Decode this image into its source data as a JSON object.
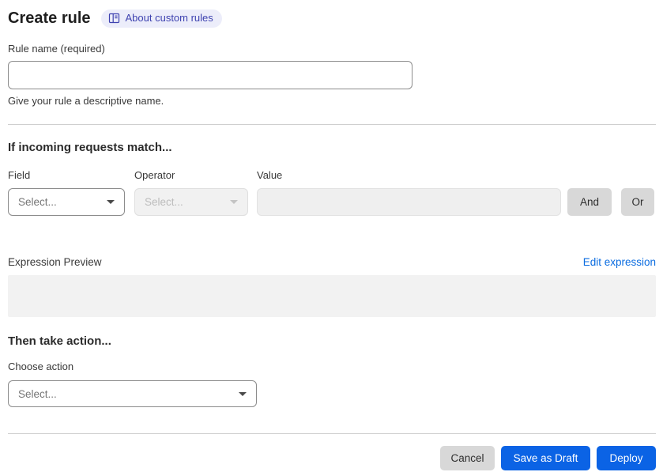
{
  "header": {
    "title": "Create rule",
    "about_link": "About custom rules"
  },
  "rule_name": {
    "label": "Rule name (required)",
    "value": "",
    "helper": "Give your rule a descriptive name."
  },
  "match_section": {
    "heading": "If incoming requests match...",
    "field": {
      "label": "Field",
      "selected": "Select..."
    },
    "operator": {
      "label": "Operator",
      "selected": "Select..."
    },
    "value": {
      "label": "Value",
      "value": ""
    },
    "and_button": "And",
    "or_button": "Or"
  },
  "expression": {
    "preview_label": "Expression Preview",
    "edit_link": "Edit expression",
    "preview_value": ""
  },
  "action_section": {
    "heading": "Then take action...",
    "choose_label": "Choose action",
    "selected": "Select..."
  },
  "footer": {
    "cancel": "Cancel",
    "save_draft": "Save as Draft",
    "deploy": "Deploy"
  },
  "colors": {
    "primary_button": "#0b63e5",
    "link": "#0b6ce0",
    "badge_bg": "#ecedfa",
    "badge_text": "#3e42b0",
    "disabled_bg": "#f1f1f1",
    "preview_bg": "#f2f2f2"
  }
}
